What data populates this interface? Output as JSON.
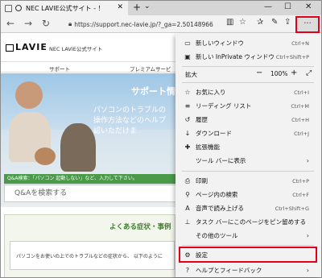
{
  "tab": {
    "title": "NEC LAVIE公式サイト - ！",
    "close": "✕"
  },
  "window": {
    "minimize": "—",
    "maximize": "☐",
    "close": "✕"
  },
  "nav": {
    "url": "https://support.nec-lavie.jp/?_ga=2.50148966",
    "more": "···"
  },
  "site": {
    "logo": "LAVIE",
    "name": "NEC LAVIE公式サイト",
    "nav": [
      "サポート",
      "プレミアムサービ"
    ]
  },
  "hero": {
    "title": "サポート情",
    "lines": [
      "パソコンのトラブルの",
      "操作方法などのヘルプ",
      "認いただけま"
    ],
    "qa_hint": "Q&A検索：「パソコン 起動しない」など、入力して下さい。",
    "qa_placeholder": "Q&Aを検索する"
  },
  "section": {
    "title": "よくある症状・事例",
    "text": "パソコンをお使いの上でのトラブルなどの症状から、 以下のように"
  },
  "menu": {
    "new_window": {
      "label": "新しいウィンドウ",
      "sc": "Ctrl+N"
    },
    "new_private": {
      "label": "新しい InPrivate ウィンドウ",
      "sc": "Ctrl+Shift+P"
    },
    "zoom": {
      "label": "拡大",
      "minus": "−",
      "value": "100%",
      "plus": "+",
      "full": "⤢"
    },
    "favorites": {
      "label": "お気に入り",
      "sc": "Ctrl+I"
    },
    "reading": {
      "label": "リーディング リスト",
      "sc": "Ctrl+M"
    },
    "history": {
      "label": "履歴",
      "sc": "Ctrl+H"
    },
    "downloads": {
      "label": "ダウンロード",
      "sc": "Ctrl+J"
    },
    "extensions": {
      "label": "拡張機能"
    },
    "toolbar": {
      "label": "ツール バーに表示",
      "arrow": "›"
    },
    "print": {
      "label": "印刷",
      "sc": "Ctrl+P"
    },
    "find": {
      "label": "ページ内の検索",
      "sc": "Ctrl+F"
    },
    "read_aloud": {
      "label": "音声で読み上げる",
      "sc": "Ctrl+Shift+G"
    },
    "pin": {
      "label": "タスク バーにこのページをピン留めする"
    },
    "more_tools": {
      "label": "その他のツール",
      "arrow": "›"
    },
    "settings": {
      "label": "設定"
    },
    "help": {
      "label": "ヘルプとフィードバック",
      "arrow": "›"
    }
  },
  "colors": {
    "highlight": "#e4001b",
    "qa_green": "#4a9a4a"
  }
}
